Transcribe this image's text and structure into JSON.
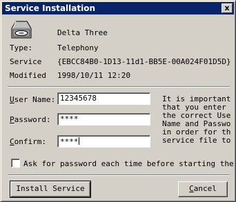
{
  "window": {
    "title": "Service Installation",
    "close_glyph": "x"
  },
  "icon": {
    "name": "disk-drive-icon"
  },
  "service": {
    "name": "Delta Three",
    "type_label": "Type:",
    "type_value": "Telephony",
    "service_label": "Service",
    "service_value": "{EBCC84B0-1D13-11d1-BB5E-00A024F01D5D}",
    "modified_label": "Modified",
    "modified_value": "1998/10/11  12:20"
  },
  "form": {
    "username_label_hotkey": "U",
    "username_label_rest": "ser Name:",
    "username_value": "12345678",
    "password_label_hotkey": "P",
    "password_label_rest": "assword:",
    "password_value": "****",
    "confirm_label_hotkey": "C",
    "confirm_label_rest": "onfirm:",
    "confirm_value": "****"
  },
  "info_text": "It is important\nthat you enter\nthe correct User\nName and Password\nin order for the\nservice file to\n    ...",
  "ask_password": {
    "label": "Ask for password each time before starting the",
    "checked": false
  },
  "buttons": {
    "install_label": "Install Service",
    "cancel_hotkey": "C",
    "cancel_rest": "ancel"
  }
}
